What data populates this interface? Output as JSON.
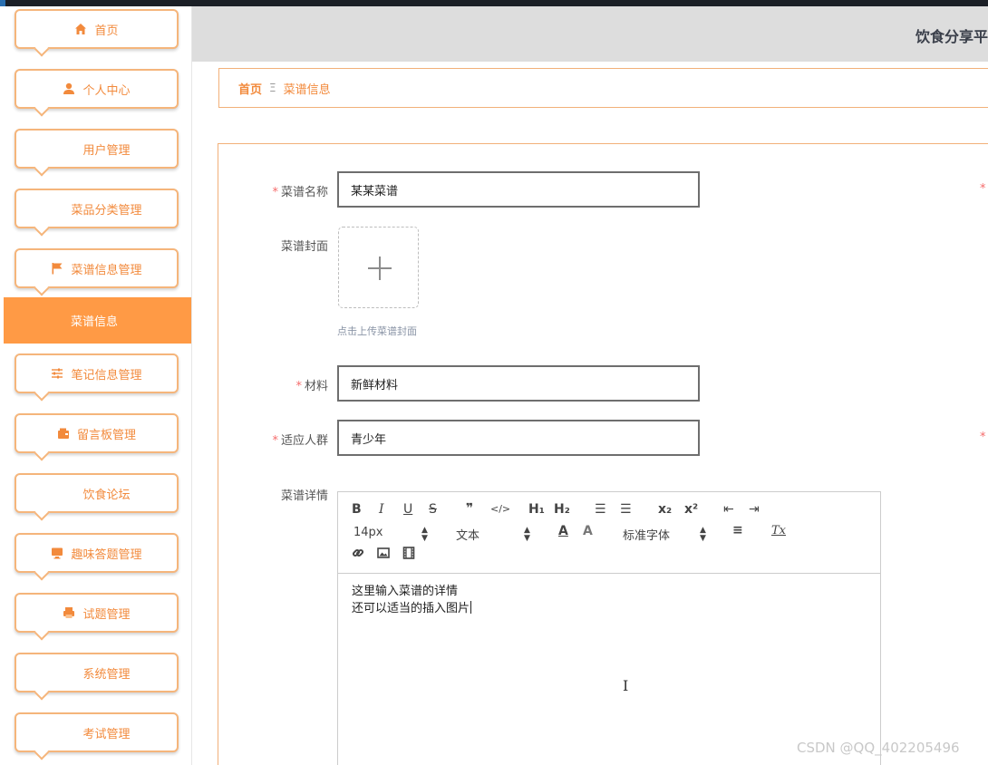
{
  "header": {
    "title": "饮食分享平"
  },
  "sidebar": {
    "items": [
      {
        "label": "首页",
        "icon": "home-icon"
      },
      {
        "label": "个人中心",
        "icon": "user-icon"
      },
      {
        "label": "用户管理",
        "icon": "grid-icon"
      },
      {
        "label": "菜品分类管理",
        "icon": "grid-icon"
      },
      {
        "label": "菜谱信息管理",
        "icon": "flag-icon"
      },
      {
        "label": "笔记信息管理",
        "icon": "sliders-icon"
      },
      {
        "label": "留言板管理",
        "icon": "wallet-icon"
      },
      {
        "label": "饮食论坛",
        "icon": "grid-icon"
      },
      {
        "label": "趣味答题管理",
        "icon": "monitor-icon"
      },
      {
        "label": "试题管理",
        "icon": "printer-icon"
      },
      {
        "label": "系统管理",
        "icon": "grid-icon"
      },
      {
        "label": "考试管理",
        "icon": "grid-icon"
      }
    ],
    "active_sub": "菜谱信息"
  },
  "breadcrumb": {
    "home": "首页",
    "separator": "Ξ",
    "current": "菜谱信息"
  },
  "form": {
    "name_label": "菜谱名称",
    "name_value": "某某菜谱",
    "cover_label": "菜谱封面",
    "cover_hint": "点击上传菜谱封面",
    "material_label": "材料",
    "material_value": "新鲜材料",
    "audience_label": "适应人群",
    "audience_value": "青少年",
    "detail_label": "菜谱详情",
    "required_mark": "*"
  },
  "editor": {
    "toolbar": {
      "bold": "B",
      "italic": "I",
      "underline": "U",
      "strike": "S",
      "quote": "❞",
      "code": "</>",
      "h1": "H₁",
      "h2": "H₂",
      "ordered_list": "☰",
      "bullet_list": "☰",
      "subscript": "x₂",
      "superscript": "x²",
      "outdent": "⇤",
      "indent": "⇥",
      "size_value": "14px",
      "header_value": "文本",
      "font_value": "标准字体",
      "color": "A",
      "background": "A",
      "align": "≡",
      "clean": "Tx"
    },
    "content_line1": "这里输入菜谱的详情",
    "content_line2": "还可以适当的插入图片"
  },
  "watermark": "CSDN @QQ_402205496",
  "colors": {
    "accent": "#f28a3c",
    "active_bg": "#ff9a45",
    "required": "#f56c6c"
  }
}
